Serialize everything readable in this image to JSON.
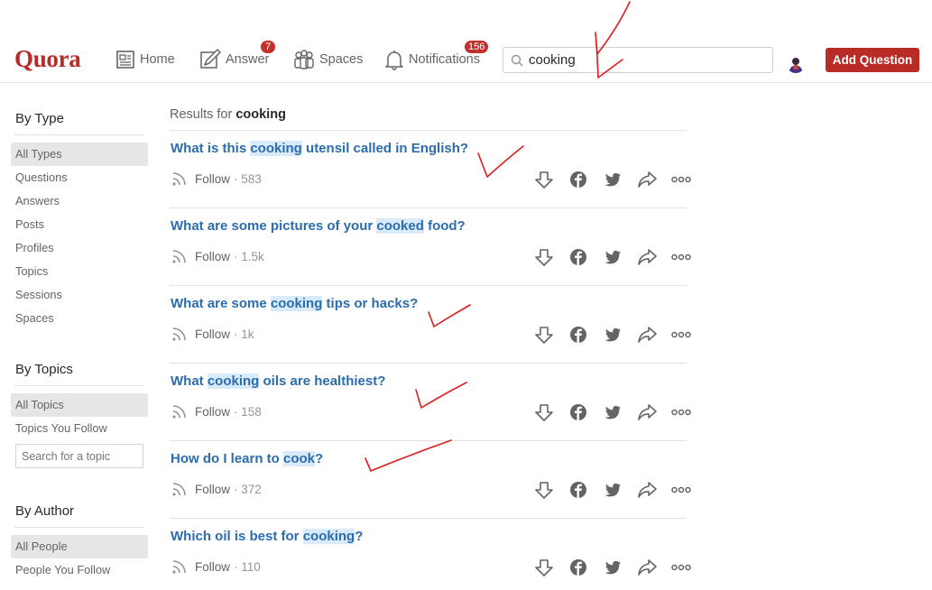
{
  "header": {
    "logo": "Quora",
    "nav": {
      "home": "Home",
      "answer": "Answer",
      "answer_badge": "7",
      "spaces": "Spaces",
      "notifications": "Notifications",
      "notifications_badge": "156"
    },
    "search_value": "cooking",
    "add_question": "Add Question"
  },
  "sidebar": {
    "by_type": {
      "title": "By Type",
      "items": [
        "All Types",
        "Questions",
        "Answers",
        "Posts",
        "Profiles",
        "Topics",
        "Sessions",
        "Spaces"
      ]
    },
    "by_topics": {
      "title": "By Topics",
      "items": [
        "All Topics",
        "Topics You Follow"
      ],
      "search_placeholder": "Search for a topic"
    },
    "by_author": {
      "title": "By Author",
      "items": [
        "All People",
        "People You Follow"
      ]
    }
  },
  "results": {
    "prefix": "Results for",
    "query": "cooking",
    "follow_label": "Follow",
    "items": [
      {
        "pre": "What is this ",
        "hl": "cooking",
        "post": " utensil called in English?",
        "count": "583"
      },
      {
        "pre": "What are some pictures of your ",
        "hl": "cooked",
        "post": " food?",
        "count": "1.5k"
      },
      {
        "pre": "What are some ",
        "hl": "cooking",
        "post": " tips or hacks?",
        "count": "1k"
      },
      {
        "pre": "What ",
        "hl": "cooking",
        "post": " oils are healthiest?",
        "count": "158"
      },
      {
        "pre": "How do I learn to ",
        "hl": "cook",
        "post": "?",
        "count": "372"
      },
      {
        "pre": "Which oil is best for ",
        "hl": "cooking",
        "post": "?",
        "count": "110"
      }
    ]
  },
  "colors": {
    "brand": "#b92b27",
    "link": "#2b6dad",
    "highlight": "#d9ebfa",
    "annotation": "#e01b1b"
  },
  "icons": {
    "nav": [
      "home-icon",
      "answer-pencil-icon",
      "spaces-icon",
      "bell-icon"
    ],
    "search": "search-icon",
    "follow": "rss-follow-icon",
    "actions": [
      "downvote-icon",
      "facebook-icon",
      "twitter-icon",
      "share-icon",
      "more-icon"
    ]
  }
}
